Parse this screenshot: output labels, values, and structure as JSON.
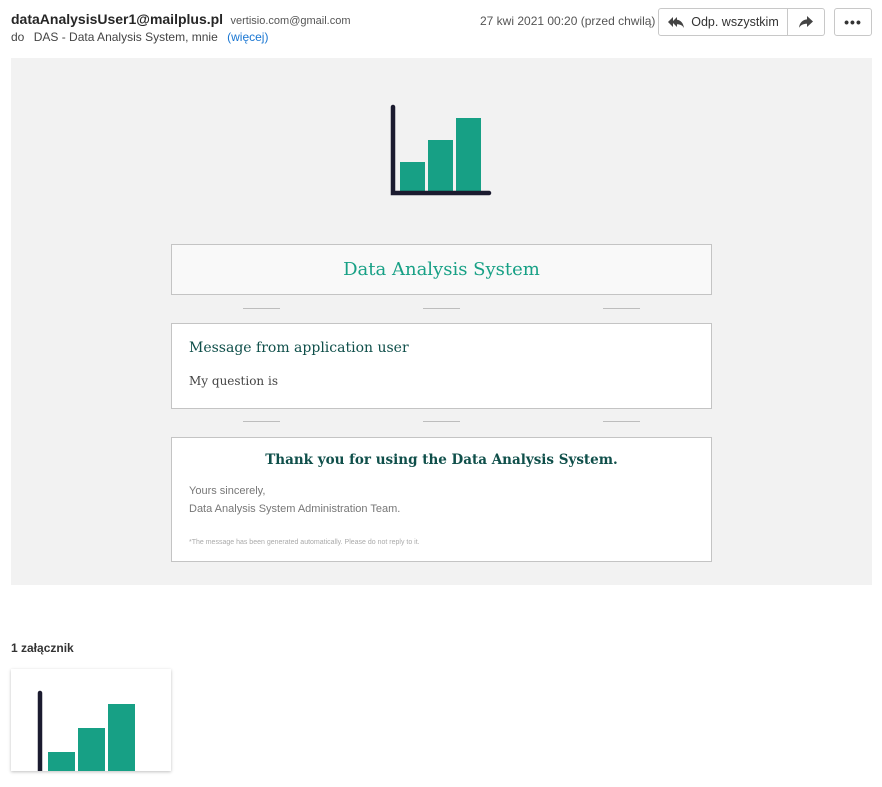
{
  "header": {
    "sender_name": "dataAnalysisUser1@mailplus.pl",
    "sender_address": "vertisio.com@gmail.com",
    "to_label": "do",
    "recipients": "DAS - Data Analysis System, mnie",
    "more_link": "(więcej)",
    "date": "27 kwi 2021 00:20 (przed chwilą)",
    "reply_all_label": "Odp. wszystkim",
    "icons": {
      "reply_all": "reply-all-icon",
      "forward": "forward-icon",
      "more": "more-icon"
    }
  },
  "email": {
    "title": "Data Analysis System",
    "message_heading": "Message from application user",
    "message_text": "My question is",
    "thanks": "Thank you for using the Data Analysis System.",
    "signature_line1": "Yours sincerely,",
    "signature_line2": "Data Analysis System Administration Team.",
    "auto_note": "*The message has been generated automatically. Please do not reply to it."
  },
  "attachments": {
    "title": "1 załącznik"
  },
  "colors": {
    "accent": "#17a085",
    "dark_heading": "#0f4f4a",
    "logo_axis": "#1b1b2f",
    "link": "#1976d2",
    "mail_background": "#f2f2f2"
  }
}
